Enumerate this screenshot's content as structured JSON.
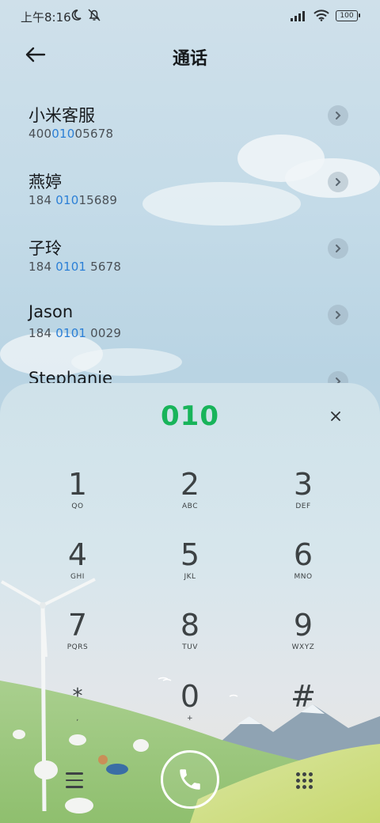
{
  "status_bar": {
    "time": "上午8:16",
    "battery": "100",
    "icons": [
      "moon-icon",
      "bell-muted-icon",
      "signal-icon",
      "wifi-icon",
      "battery-icon"
    ]
  },
  "header": {
    "title": "通话",
    "back_icon": "arrow-left-icon"
  },
  "contacts": [
    {
      "name": "小米客服",
      "number_pre": "400",
      "number_hl": "010",
      "number_post": "05678"
    },
    {
      "name": "燕婷",
      "number_pre": "184 ",
      "number_hl": "010",
      "number_post": "15689"
    },
    {
      "name": "子玲",
      "number_pre": "184 ",
      "number_hl": "0101",
      "number_post": " 5678"
    },
    {
      "name": "Jason",
      "number_pre": "184 ",
      "number_hl": "0101",
      "number_post": " 0029"
    },
    {
      "name": "Stephanie",
      "number_pre": "",
      "number_hl": "",
      "number_post": ""
    }
  ],
  "dialpad": {
    "number": "010",
    "clear_icon": "close-icon",
    "keys": [
      {
        "digit": "1",
        "letters": "QO"
      },
      {
        "digit": "2",
        "letters": "ABC"
      },
      {
        "digit": "3",
        "letters": "DEF"
      },
      {
        "digit": "4",
        "letters": "GHI"
      },
      {
        "digit": "5",
        "letters": "JKL"
      },
      {
        "digit": "6",
        "letters": "MNO"
      },
      {
        "digit": "7",
        "letters": "PQRS"
      },
      {
        "digit": "8",
        "letters": "TUV"
      },
      {
        "digit": "9",
        "letters": "WXYZ"
      },
      {
        "digit": "*",
        "letters": ","
      },
      {
        "digit": "0",
        "letters": "+"
      },
      {
        "digit": "#",
        "letters": ""
      }
    ]
  },
  "bottom_bar": {
    "menu_icon": "menu-icon",
    "call_icon": "phone-icon",
    "keypad_icon": "keypad-icon"
  },
  "colors": {
    "accent_green": "#18b45a",
    "highlight_blue": "#2b7fd6"
  }
}
